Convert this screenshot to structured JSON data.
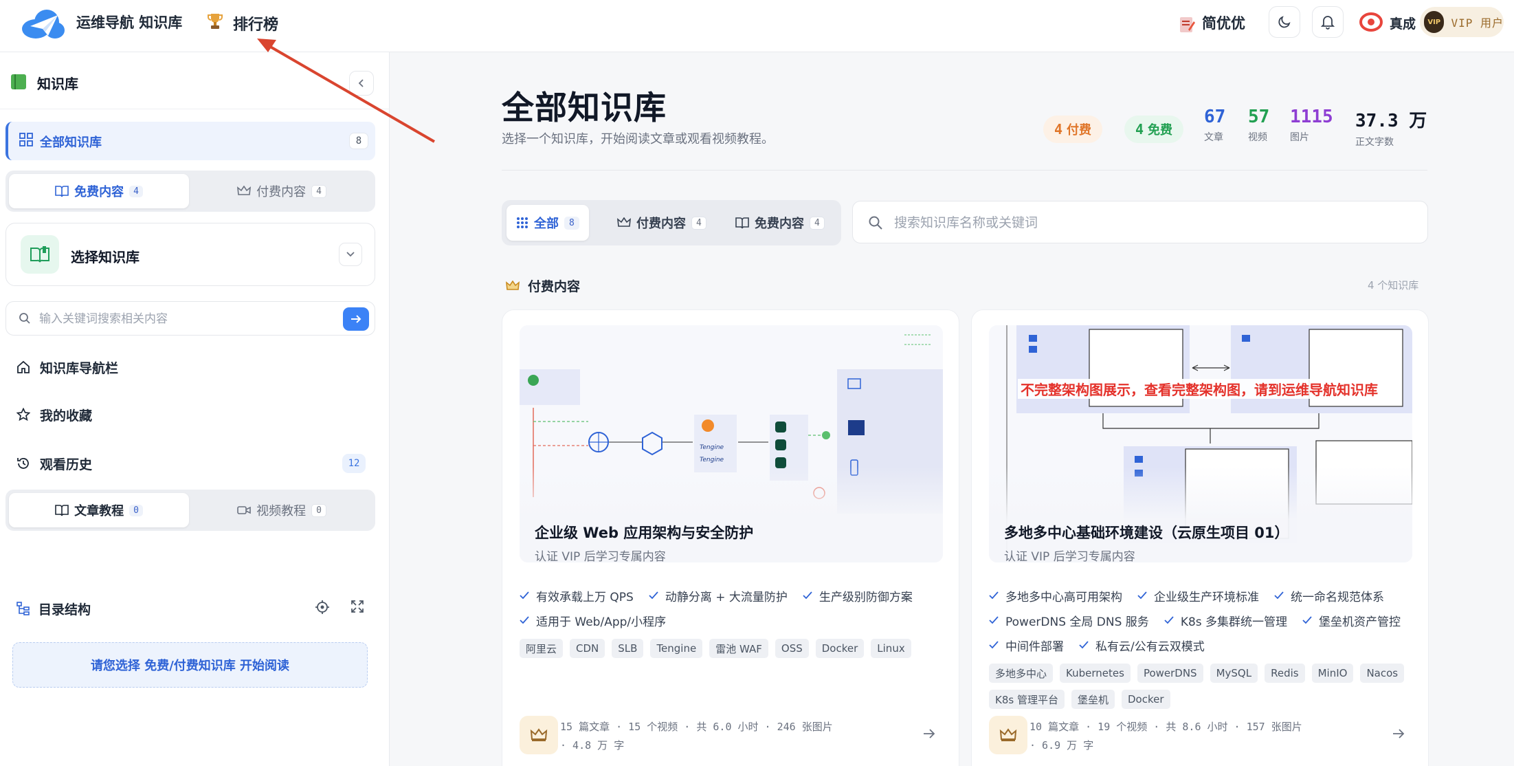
{
  "topbar": {
    "brand": "运维导航 知识库",
    "rank_label": "排行榜",
    "rank_icon": "trophy-icon",
    "jianyouyou": "简优优",
    "user_name": "真成",
    "vip_badge": "VIP",
    "vip_label": "VIP 用户"
  },
  "sidebar": {
    "title": "知识库",
    "all_kb": {
      "label": "全部知识库",
      "count": "8"
    },
    "content_tabs": [
      {
        "label": "免费内容",
        "count": "4",
        "active": true
      },
      {
        "label": "付费内容",
        "count": "4",
        "active": false
      }
    ],
    "select_kb_label": "选择知识库",
    "search_placeholder": "输入关键词搜索相关内容",
    "nav": [
      {
        "label": "知识库导航栏",
        "icon": "home-icon"
      },
      {
        "label": "我的收藏",
        "icon": "star-icon"
      },
      {
        "label": "观看历史",
        "icon": "history-icon",
        "count": "12"
      }
    ],
    "tutorial_tabs": [
      {
        "label": "文章教程",
        "count": "0",
        "active": true
      },
      {
        "label": "视频教程",
        "count": "0",
        "active": false
      }
    ],
    "toc_label": "目录结构",
    "notice": "请您选择 免费/付费知识库 开始阅读"
  },
  "main": {
    "title": "全部知识库",
    "subtitle": "选择一个知识库，开始阅读文章或观看视频教程。",
    "pills": {
      "paid": {
        "count": "4",
        "label": "付费"
      },
      "free": {
        "count": "4",
        "label": "免费"
      }
    },
    "stats": [
      {
        "value": "67",
        "label": "文章"
      },
      {
        "value": "57",
        "label": "视频"
      },
      {
        "value": "1115",
        "label": "图片"
      },
      {
        "value": "37.3 万",
        "label": "正文字数"
      }
    ],
    "filters": [
      {
        "label": "全部",
        "count": "8",
        "active": true
      },
      {
        "label": "付费内容",
        "count": "4",
        "active": false
      },
      {
        "label": "免费内容",
        "count": "4",
        "active": false
      }
    ],
    "search_placeholder": "搜索知识库名称或关键词",
    "section": {
      "title": "付费内容",
      "count_label": "4 个知识库"
    },
    "cards": [
      {
        "title": "企业级 Web 应用架构与安全防护",
        "subtitle": "认证 VIP 后学习专属内容",
        "banner": "",
        "features": [
          "有效承载上万 QPS",
          "动静分离 + 大流量防护",
          "生产级别防御方案",
          "适用于 Web/App/小程序"
        ],
        "tags": [
          "阿里云",
          "CDN",
          "SLB",
          "Tengine",
          "雷池 WAF",
          "OSS",
          "Docker",
          "Linux"
        ],
        "meta_line1": "15 篇文章 · 15 个视频 · 共 6.0 小时 · 246 张图片",
        "meta_line2": "· 4.8 万 字"
      },
      {
        "title": "多地多中心基础环境建设（云原生项目 01）",
        "subtitle": "认证 VIP 后学习专属内容",
        "banner": "不完整架构图展示，查看完整架构图，请到运维导航知识库",
        "features": [
          "多地多中心高可用架构",
          "企业级生产环境标准",
          "统一命名规范体系",
          "PowerDNS 全局 DNS 服务",
          "K8s 多集群统一管理",
          "堡垒机资产管控",
          "中间件部署",
          "私有云/公有云双模式"
        ],
        "tags": [
          "多地多中心",
          "Kubernetes",
          "PowerDNS",
          "MySQL",
          "Redis",
          "MinIO",
          "Nacos",
          "K8s 管理平台",
          "堡垒机",
          "Docker"
        ],
        "meta_line1": "10 篇文章 · 19 个视频 · 共 8.6 小时 · 157 张图片",
        "meta_line2": "· 6.9 万 字"
      }
    ]
  },
  "colors": {
    "accent": "#2f63d6",
    "paid": "#e0762a",
    "free": "#22a052",
    "images": "#8e3ed3",
    "annotation": "#d9452f"
  }
}
